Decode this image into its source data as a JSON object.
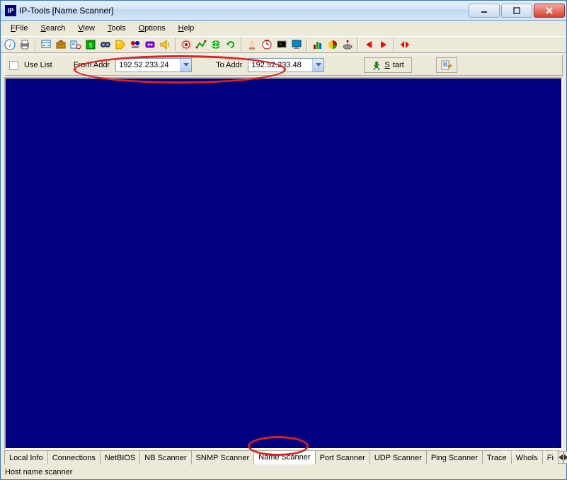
{
  "window": {
    "title": "IP-Tools [Name Scanner]",
    "app_icon_text": "IP"
  },
  "menu": {
    "file": "File",
    "search": "Search",
    "view": "View",
    "tools": "Tools",
    "options": "Options",
    "help": "Help"
  },
  "toolbar_icons": [
    "info-icon",
    "print-icon",
    "sep",
    "connections-icon",
    "netbios-icon",
    "nbscanner-icon",
    "snmp-icon",
    "binoculars-icon",
    "tag-icon",
    "port-icon",
    "udp-icon",
    "sound-icon",
    "sep",
    "ping-icon",
    "trace-icon",
    "globe-icon",
    "refresh-icon",
    "sep",
    "finger-icon",
    "clock-icon",
    "telnet-icon",
    "monitor-icon",
    "sep",
    "chart-icon",
    "pie-icon",
    "satellite-icon",
    "sep",
    "arrow-left-icon",
    "arrow-right-icon",
    "sep",
    "arrows-collapse-icon"
  ],
  "params": {
    "use_list_label": "Use List",
    "from_label": "From Addr",
    "from_value": "192.52.233.24",
    "to_label": "To Addr",
    "to_value": "192.52.233.48",
    "start_label": "Start"
  },
  "tabs": [
    {
      "label": "Local Info",
      "active": false
    },
    {
      "label": "Connections",
      "active": false
    },
    {
      "label": "NetBIOS",
      "active": false
    },
    {
      "label": "NB Scanner",
      "active": false
    },
    {
      "label": "SNMP Scanner",
      "active": false
    },
    {
      "label": "Name Scanner",
      "active": true
    },
    {
      "label": "Port Scanner",
      "active": false
    },
    {
      "label": "UDP Scanner",
      "active": false
    },
    {
      "label": "Ping Scanner",
      "active": false
    },
    {
      "label": "Trace",
      "active": false
    },
    {
      "label": "WhoIs",
      "active": false
    },
    {
      "label": "Fi",
      "active": false
    }
  ],
  "status": {
    "text": "Host name scanner"
  },
  "watermark": "头条 @马王爷",
  "colors": {
    "content_bg": "#000080",
    "ellipse": "#e02020"
  }
}
